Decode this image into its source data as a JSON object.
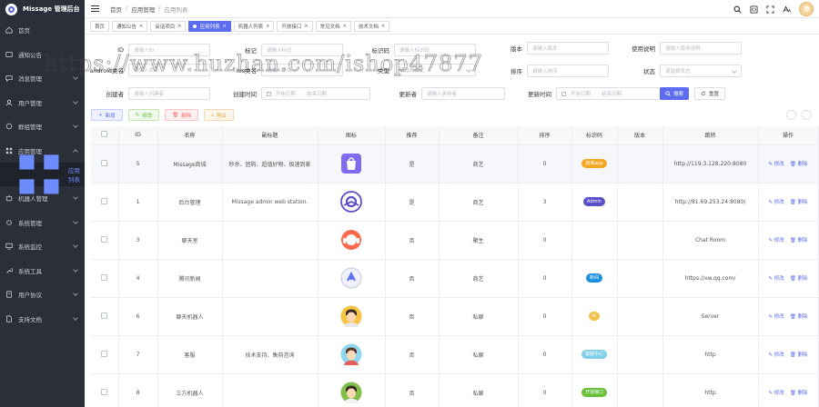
{
  "brand": {
    "title": "Missage 管理后台"
  },
  "sidebar": {
    "items": [
      {
        "label": "首页",
        "icon": "home-icon"
      },
      {
        "label": "通知公告",
        "icon": "notice-icon"
      },
      {
        "label": "消息管理",
        "icon": "message-icon"
      },
      {
        "label": "用户管理",
        "icon": "user-icon"
      },
      {
        "label": "群组管理",
        "icon": "group-icon"
      },
      {
        "label": "应用管理",
        "icon": "app-icon",
        "open": true
      },
      {
        "label": "应用列表",
        "icon": "grid-icon",
        "sub": true
      },
      {
        "label": "机器人管理",
        "icon": "robot-icon"
      },
      {
        "label": "系统管理",
        "icon": "gear-icon"
      },
      {
        "label": "系统监控",
        "icon": "monitor-icon"
      },
      {
        "label": "系统工具",
        "icon": "tool-icon"
      },
      {
        "label": "用户协议",
        "icon": "protocol-icon"
      },
      {
        "label": "支持文档",
        "icon": "doc-icon"
      }
    ]
  },
  "header": {
    "breadcrumbs": [
      "首页",
      "应用管理",
      "应用列表"
    ]
  },
  "tags": [
    "首页",
    "通知公告",
    "会话项目",
    "应用列表",
    "机器人列表",
    "开放接口",
    "常见文档",
    "技术文档"
  ],
  "filters": {
    "id": {
      "label": "ID",
      "placeholder": "请输入ID"
    },
    "flag": {
      "label": "标记",
      "placeholder": "请输入标记"
    },
    "identifier": {
      "label": "标识码",
      "placeholder": "请输入标识码"
    },
    "version": {
      "label": "版本",
      "placeholder": "请输入版本"
    },
    "usage": {
      "label": "使用说明",
      "placeholder": "请输入使用说明"
    },
    "android": {
      "label": "android类名",
      "placeholder": "请输入类名"
    },
    "ios": {
      "label": "ios类名",
      "placeholder": "请输入类名"
    },
    "type": {
      "label": "类型",
      "placeholder": "请选择类型"
    },
    "sort": {
      "label": "排序",
      "placeholder": "请输入排序"
    },
    "status": {
      "label": "状态",
      "placeholder": "请选择状态"
    },
    "creator": {
      "label": "创建者",
      "placeholder": "请输入创建者"
    },
    "created": {
      "label": "创建时间",
      "start": "开始日期",
      "end": "结束日期"
    },
    "updater": {
      "label": "更新者",
      "placeholder": "请输入更新者"
    },
    "updated": {
      "label": "更新时间",
      "start": "开始日期",
      "end": "结束日期"
    },
    "search_label": "搜索",
    "reset_label": "重置"
  },
  "toolbar": {
    "add": "新增",
    "edit": "修改",
    "delete": "删除",
    "export": "导出"
  },
  "table": {
    "columns": [
      "ID",
      "名称",
      "副标题",
      "图标",
      "推荐",
      "备注",
      "排序",
      "标识码",
      "版本",
      "跳转",
      "操作"
    ],
    "rows": [
      {
        "id": "5",
        "name": "Missage商城",
        "subtitle": "秒杀、团购、超值好物、极速到家",
        "icon": "shop-bag-icon",
        "recommend": "是",
        "remark": "商艺",
        "sort": "0",
        "badge": "商城app",
        "badge_color": "#f5a623",
        "version": "",
        "url": "http://119.3.128.220:8080"
      },
      {
        "id": "1",
        "name": "后台管理",
        "subtitle": "Missage admin web station.",
        "icon": "admin-logo-icon",
        "recommend": "是",
        "remark": "商艺",
        "sort": "3",
        "badge": "Admin",
        "badge_color": "#5b4fc7",
        "version": "",
        "url": "http://81.69.253.24:8080/"
      },
      {
        "id": "3",
        "name": "聊天室",
        "subtitle": "",
        "icon": "customer-service-icon",
        "recommend": "否",
        "remark": "聚生",
        "sort": "0",
        "badge": "",
        "badge_color": "",
        "version": "",
        "url": "Chat Room"
      },
      {
        "id": "4",
        "name": "腾讯新闻",
        "subtitle": "",
        "icon": "news-app-icon",
        "recommend": "否",
        "remark": "商艺",
        "sort": "0",
        "badge": "新闻",
        "badge_color": "#1a8fe0",
        "version": "",
        "url": "https://xw.qq.com/"
      },
      {
        "id": "6",
        "name": "聊天机器人",
        "subtitle": "",
        "icon": "robot-avatar-icon",
        "recommend": "否",
        "remark": "私聊",
        "sort": "0",
        "badge": "AI",
        "badge_color": "#f5c14a",
        "version": "",
        "url": "Server"
      },
      {
        "id": "7",
        "name": "客服",
        "subtitle": "技术支持、售前咨询",
        "icon": "service-avatar-icon",
        "recommend": "否",
        "remark": "私聊",
        "sort": "0",
        "badge": "客服中心",
        "badge_color": "#7fd0e8",
        "version": "",
        "url": "http"
      },
      {
        "id": "8",
        "name": "三方机器人",
        "subtitle": "",
        "icon": "third-robot-avatar-icon",
        "recommend": "否",
        "remark": "私聊",
        "sort": "0",
        "badge": "开放接口",
        "badge_color": "#67c23a",
        "version": "",
        "url": "http"
      }
    ],
    "op_edit": "修改",
    "op_delete": "删除"
  },
  "watermark": "https://www.huzhan.com/ishop47877",
  "colors": {
    "accent": "#5b6cf0",
    "sidebar": "#2b2f3a"
  }
}
